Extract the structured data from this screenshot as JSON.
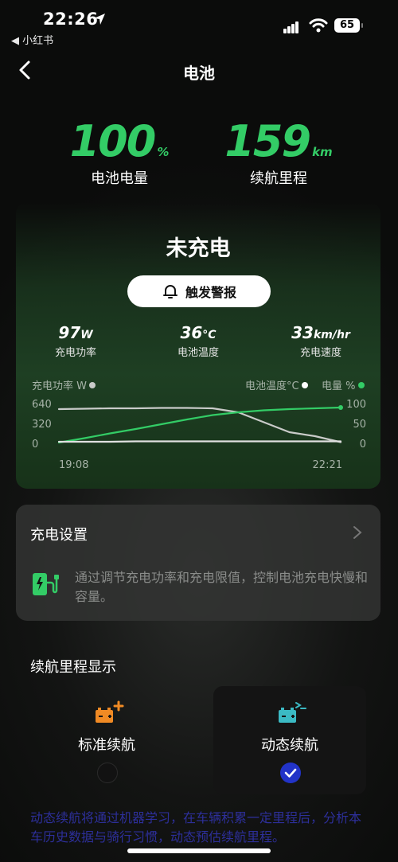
{
  "status_bar": {
    "time": "22:26",
    "back_app": "◀ 小红书",
    "battery": "65"
  },
  "nav": {
    "title": "电池"
  },
  "stats": [
    {
      "value": "100",
      "unit": "%",
      "label": "电池电量"
    },
    {
      "value": "159",
      "unit": "km",
      "label": "续航里程"
    }
  ],
  "status_card": {
    "state": "未充电",
    "alarm_label": "触发警报",
    "metrics": [
      {
        "value": "97",
        "unit": "W",
        "label": "充电功率"
      },
      {
        "value": "36",
        "unit": "°C",
        "label": "电池温度"
      },
      {
        "value": "33",
        "unit": "km/hr",
        "label": "充电速度"
      }
    ],
    "legend": {
      "power": "充电功率 W",
      "temp": "电池温度°C",
      "level": "电量 %"
    }
  },
  "chart_data": {
    "type": "line",
    "x": [
      "19:08",
      "22:21"
    ],
    "left_axis": {
      "label": "充电功率 W",
      "ticks": [
        "640",
        "320",
        "0"
      ],
      "range": [
        0,
        640
      ]
    },
    "right_axis": {
      "label": "电量 %",
      "ticks": [
        "100",
        "50",
        "0"
      ],
      "range": [
        0,
        100
      ]
    },
    "series": [
      {
        "name": "电池温度°C",
        "color": "#c9cbc9",
        "values": [
          88,
          89,
          90,
          90,
          91,
          91,
          90,
          80,
          55,
          30,
          20,
          5
        ]
      },
      {
        "name": "电量 %",
        "color": "#33cc66",
        "values": [
          4,
          15,
          27,
          38,
          50,
          62,
          73,
          80,
          85,
          88,
          90,
          92
        ]
      },
      {
        "name": "充电功率 W",
        "color": "#e0e0e0",
        "values": [
          6,
          6,
          6,
          7,
          7,
          7,
          7,
          7,
          7,
          7,
          7,
          7
        ]
      }
    ]
  },
  "settings": {
    "title": "充电设置",
    "desc": "通过调节充电功率和充电限值，控制电池充电快慢和容量。"
  },
  "range_display": {
    "title": "续航里程显示",
    "options": [
      {
        "label": "标准续航",
        "selected": false
      },
      {
        "label": "动态续航",
        "selected": true
      }
    ],
    "desc": "动态续航将通过机器学习，在车辆积累一定里程后，分析本车历史数据与骑行习惯，动态预估续航里程。"
  },
  "colors": {
    "accent_green": "#33cc66",
    "select_blue": "#2233c8",
    "icon_orange": "#f08a24",
    "icon_teal": "#3bbac4"
  }
}
